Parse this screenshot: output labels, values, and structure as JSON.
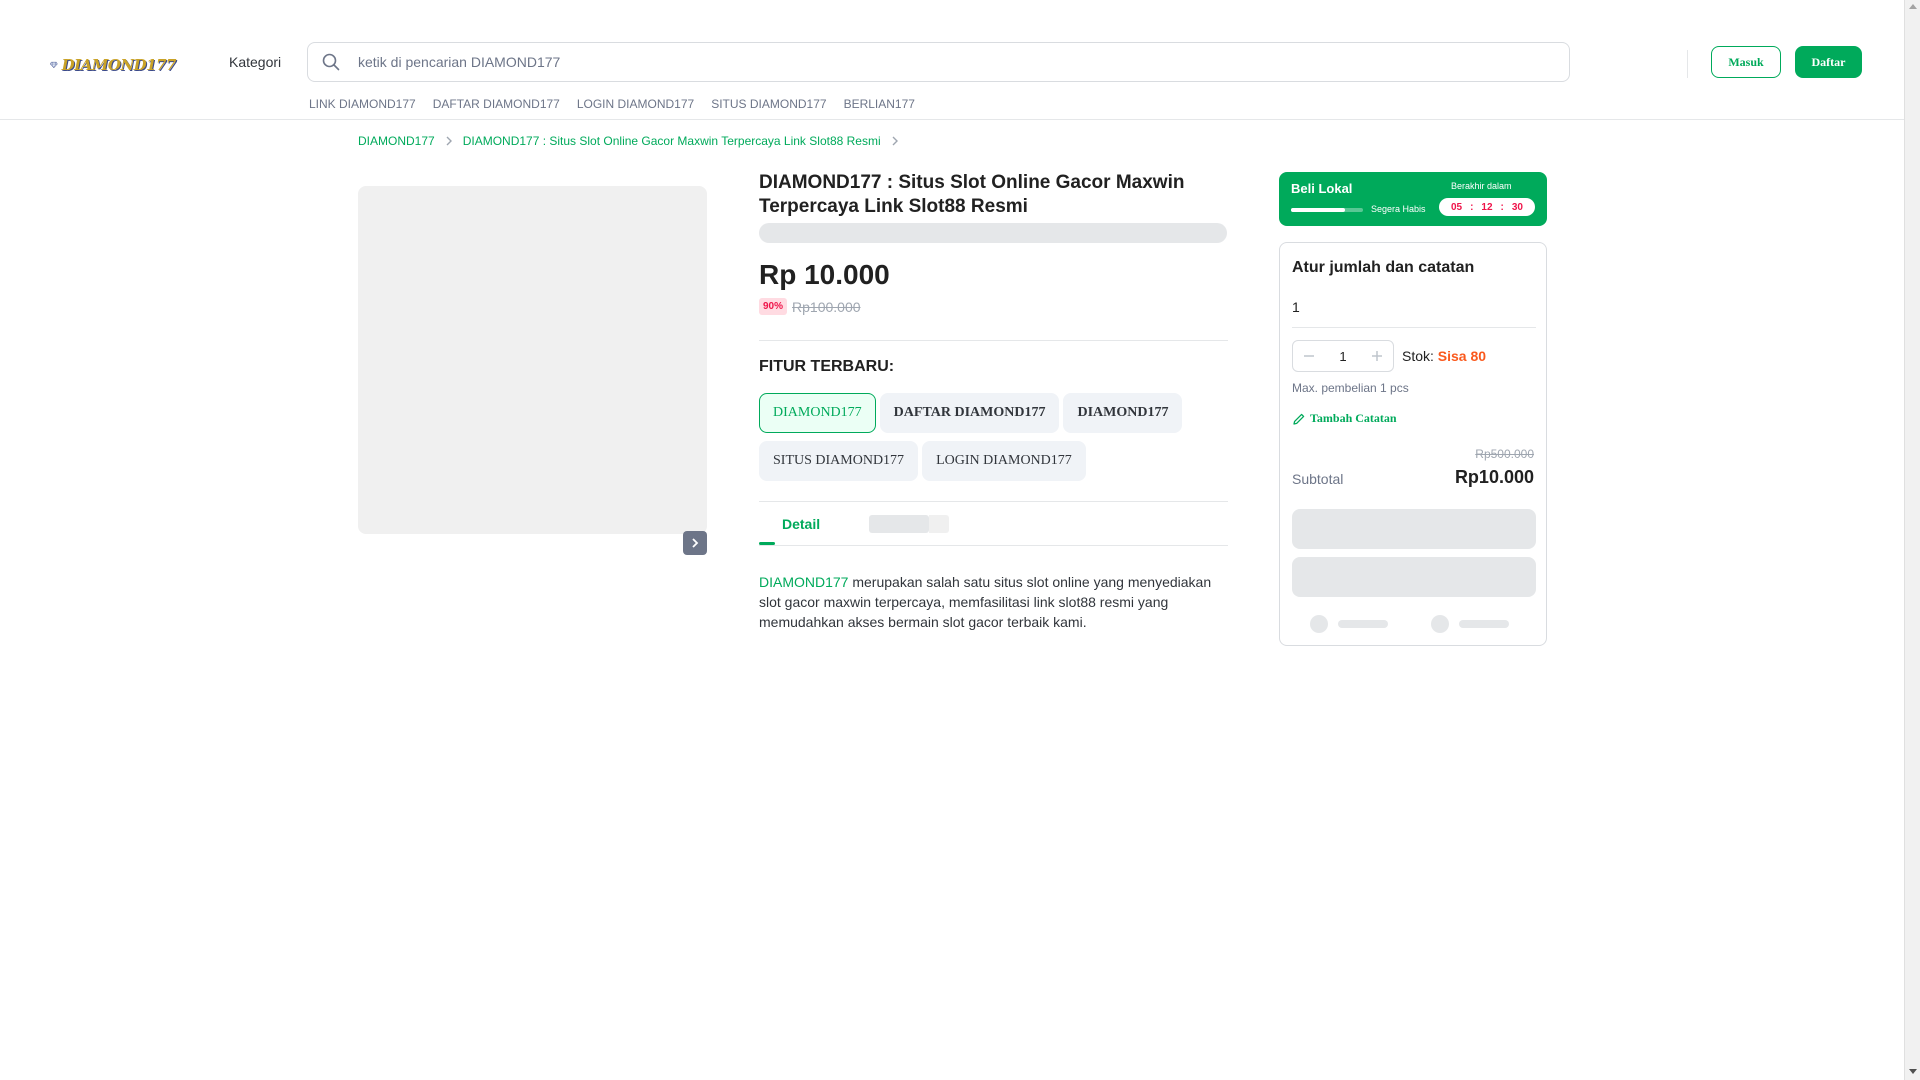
{
  "header": {
    "logo_text": "DIAMOND177",
    "kategori_label": "Kategori",
    "search_placeholder": "ketik di pencarian DIAMOND177",
    "quick_links": [
      "LINK DIAMOND177",
      "DAFTAR DIAMOND177",
      "LOGIN DIAMOND177",
      "SITUS DIAMOND177",
      "BERLIAN177"
    ],
    "login_label": "Masuk",
    "register_label": "Daftar"
  },
  "breadcrumb": {
    "items": [
      "DIAMOND177",
      "DIAMOND177 : Situs Slot Online Gacor Maxwin Terpercaya Link Slot88 Resmi"
    ]
  },
  "product": {
    "title": "DIAMOND177 : Situs Slot Online Gacor Maxwin Terpercaya Link Slot88 Resmi",
    "price": "Rp 10.000",
    "discount": "90%",
    "old_price": "Rp100.000",
    "features_title": "FITUR TERBARU:",
    "features": [
      "DIAMOND177",
      "DAFTAR DIAMOND177",
      "DIAMOND177",
      "SITUS DIAMOND177",
      "LOGIN DIAMOND177"
    ],
    "tab_detail": "Detail",
    "description_link": "DIAMOND177",
    "description_rest": " merupakan salah satu situs slot online yang menyediakan slot gacor maxwin terpercaya, memfasilitasi link slot88 resmi yang memudahkan akses bermain slot gacor terbaik kami."
  },
  "promo": {
    "title": "Beli Lokal",
    "status": "Segera Habis",
    "ends_label": "Berakhir dalam",
    "progress": 0.75,
    "countdown": {
      "hours": "05",
      "minutes": "12",
      "seconds": "30"
    },
    "separator": ":"
  },
  "purchase": {
    "title": "Atur jumlah dan catatan",
    "note_value": "1",
    "quantity": "1",
    "stock_label": "Stok: ",
    "stock_value": "Sisa 80",
    "max_purchase": "Max. pembelian 1 pcs",
    "add_note": "Tambah Catatan",
    "strike_subtotal": "Rp500.000",
    "subtotal_label": "Subtotal",
    "subtotal_value": "Rp10.000"
  },
  "colors": {
    "accent": "#00aa5b",
    "danger": "#ef144a",
    "stock": "#fa591d"
  }
}
